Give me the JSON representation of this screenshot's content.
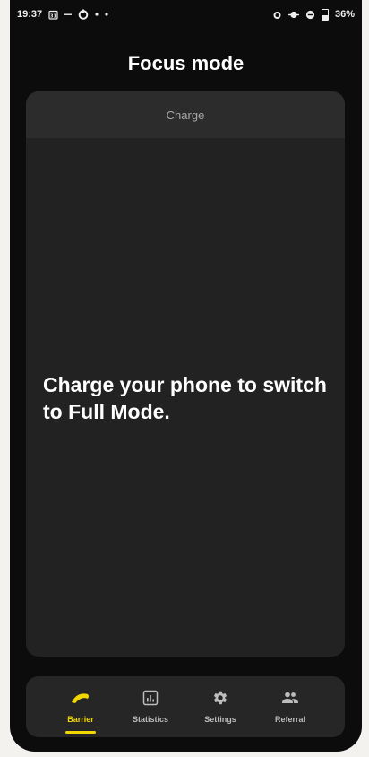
{
  "status_bar": {
    "time": "19:37",
    "left_icons": [
      "calendar-icon",
      "dash-icon",
      "power-icon",
      "dot-icon",
      "dot-icon"
    ],
    "right_icons": [
      "alarm-icon",
      "location-icon",
      "dnd-icon"
    ],
    "battery": "36%"
  },
  "page": {
    "title": "Focus mode"
  },
  "card": {
    "header": "Charge",
    "message": "Charge your phone to switch to Full Mode."
  },
  "nav": {
    "active": "barrier",
    "accent_color": "#f1d600",
    "items": [
      {
        "label": "Barrier",
        "icon": "barrier-icon"
      },
      {
        "label": "Statistics",
        "icon": "chart-icon"
      },
      {
        "label": "Settings",
        "icon": "gear-icon"
      },
      {
        "label": "Referral",
        "icon": "people-icon"
      }
    ]
  }
}
